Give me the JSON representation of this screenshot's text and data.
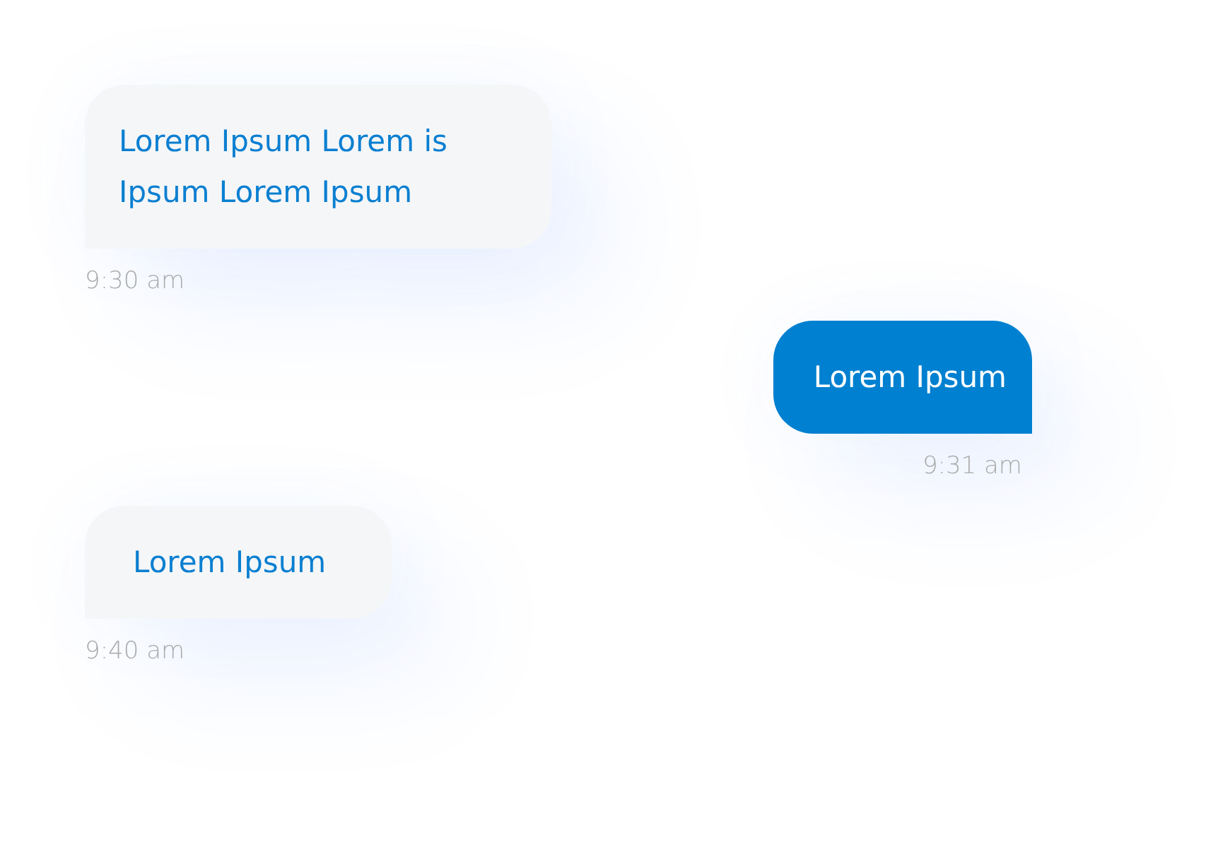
{
  "messages": [
    {
      "kind": "incoming",
      "text": "Lorem Ipsum Lorem is Ipsum Lorem Ipsum",
      "time": "9:30 am"
    },
    {
      "kind": "outgoing",
      "text": "Lorem Ipsum",
      "time": "9:31 am"
    },
    {
      "kind": "incoming",
      "text": "Lorem Ipsum",
      "time": "9:40 am"
    }
  ]
}
